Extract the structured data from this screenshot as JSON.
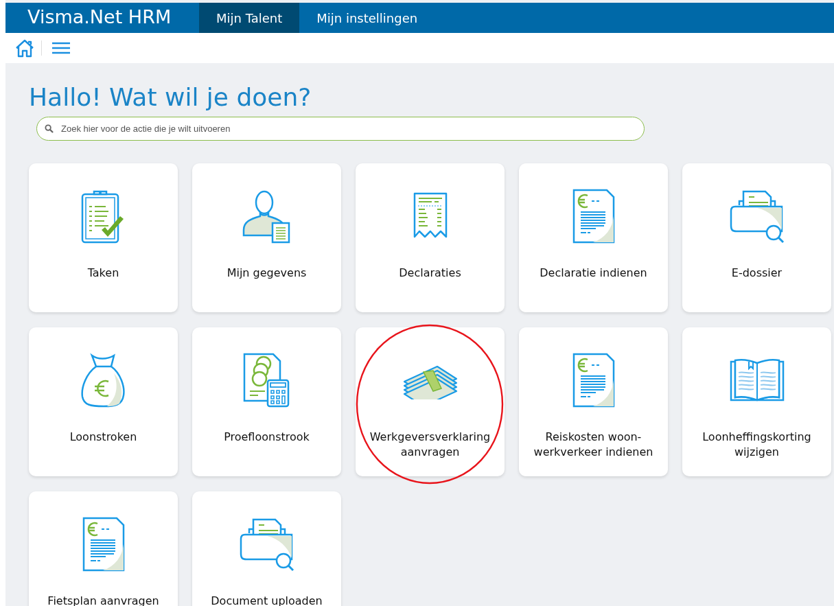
{
  "top_bar": {
    "brand": "Visma.Net HRM",
    "tabs": [
      {
        "label": "Mijn Talent",
        "selected": true
      },
      {
        "label": "Mijn instellingen",
        "selected": false
      }
    ]
  },
  "heading": "Hallo! Wat wil je doen?",
  "search": {
    "placeholder": "Zoek hier voor de actie die je wilt uitvoeren"
  },
  "tiles": [
    {
      "label": "Taken",
      "kind": "clipboard",
      "circled": false
    },
    {
      "label": "Mijn gegevens",
      "kind": "person",
      "circled": false
    },
    {
      "label": "Declaraties",
      "kind": "receipt",
      "circled": false
    },
    {
      "label": "Declaratie indienen",
      "kind": "invoice",
      "circled": false
    },
    {
      "label": "E-dossier",
      "kind": "folder",
      "circled": false
    },
    {
      "label": "Loonstroken",
      "kind": "bag",
      "circled": false
    },
    {
      "label": "Proefloonstrook",
      "kind": "calculator",
      "circled": false
    },
    {
      "label": "Werkgeversverklaring aanvragen",
      "kind": "money",
      "circled": true
    },
    {
      "label": "Reiskosten woon-werkverkeer indienen",
      "kind": "invoice",
      "circled": false
    },
    {
      "label": "Loonheffingskorting wijzigen",
      "kind": "book",
      "circled": false
    },
    {
      "label": "Fietsplan aanvragen",
      "kind": "invoice",
      "circled": false
    },
    {
      "label": "Document uploaden",
      "kind": "folder",
      "circled": false
    }
  ]
}
